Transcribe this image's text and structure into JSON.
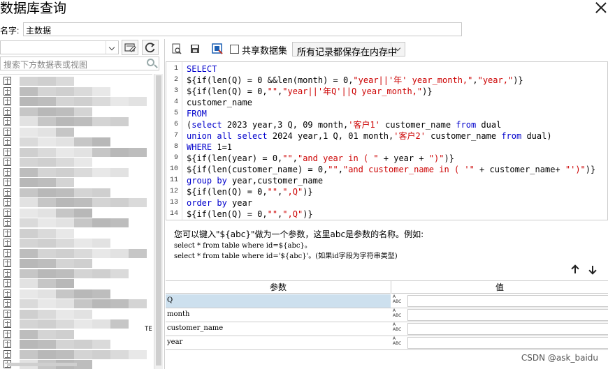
{
  "window": {
    "title": "数据库查询"
  },
  "name_field": {
    "label": "名字:",
    "value": "主数据"
  },
  "left_panel": {
    "search_placeholder": "搜索下方数据表或视图",
    "partial_text": "TE"
  },
  "toolbar": {
    "share_dataset_label": "共享数据集",
    "share_dataset_checked": false,
    "memory_mode": "所有记录都保存在内存中"
  },
  "sql_lines": [
    {
      "n": "1",
      "text": "SELECT"
    },
    {
      "n": "2",
      "text": "${if(len(Q) = 0 &&len(month) = 0,\"year||'年' year_month,\",\"year,\")}"
    },
    {
      "n": "3",
      "text": "${if(len(Q) = 0,\"\",\"year||'年Q'||Q year_month,\")}"
    },
    {
      "n": "4",
      "text": "customer_name"
    },
    {
      "n": "5",
      "text": "FROM"
    },
    {
      "n": "6",
      "text": "(select 2023 year,3 Q, 09 month,'客户1' customer_name from dual"
    },
    {
      "n": "7",
      "text": "union all select 2024 year,1 Q, 01 month,'客户2' customer_name from dual)"
    },
    {
      "n": "8",
      "text": "WHERE 1=1"
    },
    {
      "n": "9",
      "text": "${if(len(year) = 0,\"\",\"and year in ( \" + year + \")\")}"
    },
    {
      "n": "10",
      "text": "${if(len(customer_name) = 0,\"\",\"and customer_name in ( '\" + customer_name+ \"')\")}"
    },
    {
      "n": "11",
      "text": "group by year,customer_name"
    },
    {
      "n": "12",
      "text": "${if(len(Q) = 0,\"\",\",Q\")}"
    },
    {
      "n": "13",
      "text": "order by year"
    },
    {
      "n": "14",
      "text": "${if(len(Q) = 0,\"\",\",Q\")}"
    }
  ],
  "hint": {
    "line1": "您可以键入\"${abc}\"做为一个参数，这里abc是参数的名称。例如:",
    "line2": "select * from table where id=${abc}。",
    "line3": "select * from table where id='${abc}'。(如果id字段为字符串类型)"
  },
  "params": {
    "header_param": "参数",
    "header_value": "值",
    "type_label_top": "A",
    "type_label_bottom": "ABC",
    "rows": [
      {
        "name": "Q",
        "value": ""
      },
      {
        "name": "month",
        "value": ""
      },
      {
        "name": "customer_name",
        "value": ""
      },
      {
        "name": "year",
        "value": ""
      }
    ]
  },
  "watermark": "CSDN @ask_baidu"
}
